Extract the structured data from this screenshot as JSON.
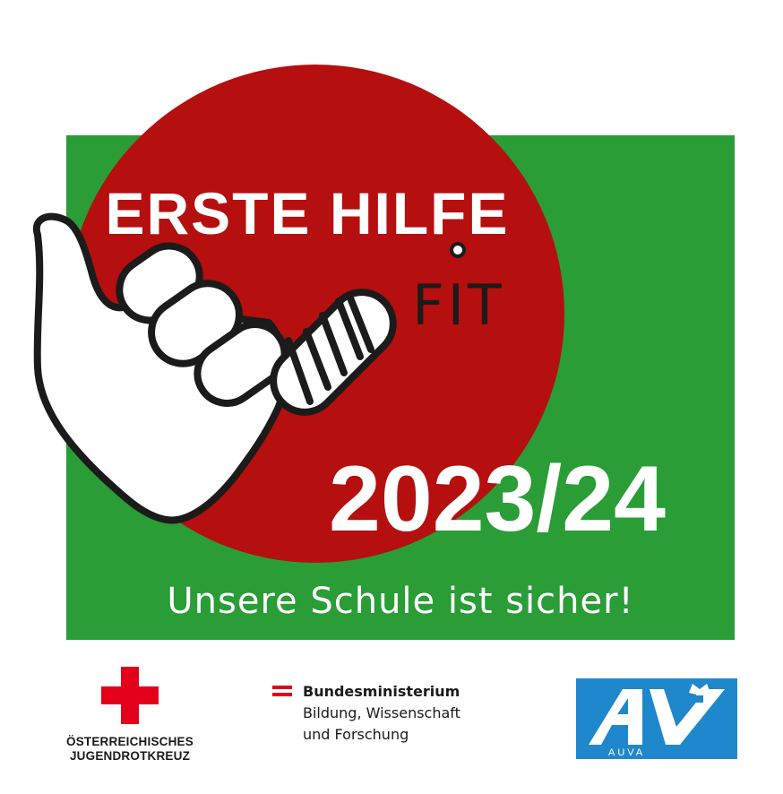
{
  "badge": {
    "title": "ERSTE HILFE",
    "fit": "FIT",
    "year": "2023/24",
    "slogan": "Unsere Schule ist sicher!"
  },
  "footer": {
    "redcross": {
      "name_line1": "ÖSTERREICHISCHES",
      "name_line2": "JUGENDROTKREUZ"
    },
    "ministry": {
      "line1": "Bundesministerium",
      "line2": "Bildung, Wissenschaft",
      "line3": "und Forschung"
    },
    "auva": {
      "label": "AUVA"
    }
  },
  "colors": {
    "green": "#2a9d37",
    "red": "#b50f0f",
    "white": "#ffffff",
    "outline": "#1b1b1b",
    "redcross": "#e3001b",
    "austria_red": "#e3001b",
    "auva_blue": "#1f88cc"
  },
  "icons": {
    "hand": "shaka-hand-with-bandaged-pinky-icon",
    "redcross": "red-cross-icon",
    "flag": "austrian-flag-icon",
    "auva": "auva-logo-icon",
    "eagle": "federal-eagle-icon"
  }
}
